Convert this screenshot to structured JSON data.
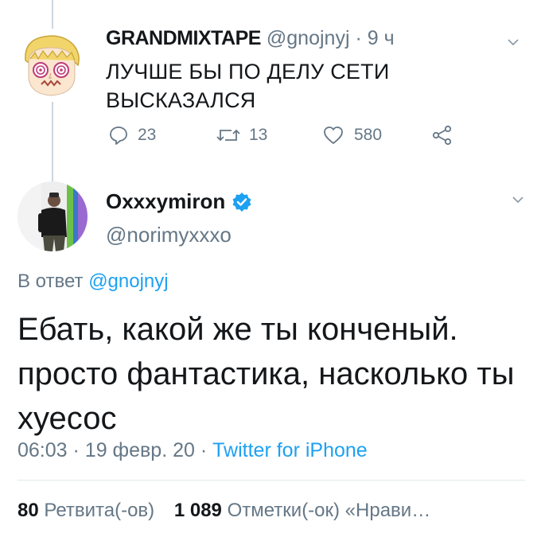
{
  "tweet1": {
    "name": "GRANDMIXTAPE",
    "handle": "@gnojnyj",
    "separator": "·",
    "time": "9 ч",
    "text": "ЛУЧШЕ БЫ ПО ДЕЛУ СЕТИ ВЫСКАЗАЛСЯ",
    "replies": "23",
    "retweets": "13",
    "likes": "580",
    "avatar_icon": "cartoon-face-avatar"
  },
  "tweet2": {
    "name": "Oxxxymiron",
    "handle": "@norimyxxxo",
    "reply_prefix": "В ответ",
    "reply_to": "@gnojnyj",
    "text": "Ебать, какой же ты конченый. просто фантастика, насколько ты хуесос",
    "time": "06:03",
    "date": "19 февр. 20",
    "separator": "·",
    "source": "Twitter for iPhone",
    "retweets_count": "80",
    "retweets_label": "Ретвита(-ов)",
    "likes_count": "1 089",
    "likes_label": "Отметки(-ок) «Нрави…",
    "avatar_icon": "person-photo-avatar"
  },
  "colors": {
    "link": "#1da1f2",
    "muted": "#657786",
    "text": "#14171a",
    "verified": "#1da1f2"
  }
}
